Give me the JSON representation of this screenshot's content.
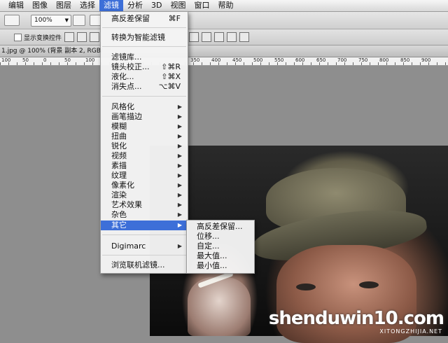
{
  "menubar": {
    "items": [
      "编辑",
      "图像",
      "图层",
      "选择",
      "滤镜",
      "分析",
      "3D",
      "视图",
      "窗口",
      "帮助"
    ],
    "active_index": 4
  },
  "toolbar": {
    "zoom_value": "100%",
    "auto_transform_label": "显示变换控件"
  },
  "document": {
    "tab_title": "1.jpg @ 100% (背景 副本 2, RGB/",
    "ruler_labels": [
      "100",
      "50",
      "0",
      "50",
      "100",
      "150",
      "200",
      "250",
      "300",
      "350",
      "400",
      "450",
      "500",
      "550",
      "600",
      "650",
      "700",
      "750",
      "800",
      "850",
      "900"
    ]
  },
  "filter_menu": {
    "top_items": [
      {
        "label": "高反差保留",
        "shortcut": "⌘F"
      },
      {
        "label": "转换为智能滤镜",
        "shortcut": ""
      }
    ],
    "group2": [
      {
        "label": "滤镜库...",
        "shortcut": ""
      },
      {
        "label": "镜头校正...",
        "shortcut": "⇧⌘R"
      },
      {
        "label": "液化...",
        "shortcut": "⇧⌘X"
      },
      {
        "label": "消失点...",
        "shortcut": "⌥⌘V"
      }
    ],
    "submenus": [
      "风格化",
      "画笔描边",
      "模糊",
      "扭曲",
      "锐化",
      "视频",
      "素描",
      "纹理",
      "像素化",
      "渲染",
      "艺术效果",
      "杂色",
      "其它"
    ],
    "highlighted": "其它",
    "digimarc": "Digimarc",
    "browse_online": "浏览联机滤镜..."
  },
  "other_submenu": {
    "items": [
      "高反差保留...",
      "位移...",
      "自定...",
      "最大值...",
      "最小值..."
    ]
  },
  "watermark": {
    "text": "shenduwin10.com",
    "sub": "XITONGZHIJIA.NET"
  },
  "colors": {
    "menu_highlight": "#3d6fd8",
    "workspace": "#8e8e8e"
  }
}
